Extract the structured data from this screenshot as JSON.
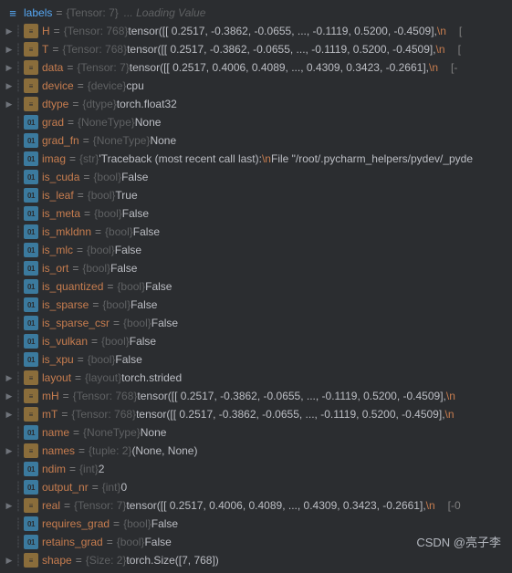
{
  "top": {
    "name": "labels",
    "type": "{Tensor: 7}",
    "loading": "... Loading Value"
  },
  "rows": [
    {
      "arrow": true,
      "pipe": true,
      "icon": "obj",
      "name": "H",
      "type": "{Tensor: 768}",
      "val": "tensor([[ 0.2517, -0.3862, -0.0655,  ..., -0.1119,  0.5200, -0.4509],",
      "esc": "\\n",
      "extra": "["
    },
    {
      "arrow": true,
      "pipe": true,
      "icon": "obj",
      "name": "T",
      "type": "{Tensor: 768}",
      "val": "tensor([[ 0.2517, -0.3862, -0.0655,  ..., -0.1119,  0.5200, -0.4509],",
      "esc": "\\n",
      "extra": "["
    },
    {
      "arrow": true,
      "pipe": true,
      "icon": "obj",
      "name": "data",
      "type": "{Tensor: 7}",
      "val": "tensor([[ 0.2517,  0.4006,  0.4089,  ...,  0.4309,  0.3423, -0.2661],",
      "esc": "\\n",
      "extra": "[-"
    },
    {
      "arrow": true,
      "pipe": true,
      "icon": "obj",
      "name": "device",
      "type": "{device}",
      "val": "cpu"
    },
    {
      "arrow": true,
      "pipe": true,
      "icon": "obj",
      "name": "dtype",
      "type": "{dtype}",
      "val": "torch.float32"
    },
    {
      "arrow": false,
      "pipe": true,
      "icon": "01",
      "name": "grad",
      "type": "{NoneType}",
      "val": "None"
    },
    {
      "arrow": false,
      "pipe": true,
      "icon": "01",
      "name": "grad_fn",
      "type": "{NoneType}",
      "val": "None"
    },
    {
      "arrow": false,
      "pipe": true,
      "icon": "01",
      "name": "imag",
      "type": "{str}",
      "val": "'Traceback (most recent call last):",
      "esc": "\\n",
      "val2": "  File \"/root/.pycharm_helpers/pydev/_pyde"
    },
    {
      "arrow": false,
      "pipe": true,
      "icon": "01",
      "name": "is_cuda",
      "type": "{bool}",
      "val": "False"
    },
    {
      "arrow": false,
      "pipe": true,
      "icon": "01",
      "name": "is_leaf",
      "type": "{bool}",
      "val": "True"
    },
    {
      "arrow": false,
      "pipe": true,
      "icon": "01",
      "name": "is_meta",
      "type": "{bool}",
      "val": "False"
    },
    {
      "arrow": false,
      "pipe": true,
      "icon": "01",
      "name": "is_mkldnn",
      "type": "{bool}",
      "val": "False"
    },
    {
      "arrow": false,
      "pipe": true,
      "icon": "01",
      "name": "is_mlc",
      "type": "{bool}",
      "val": "False"
    },
    {
      "arrow": false,
      "pipe": true,
      "icon": "01",
      "name": "is_ort",
      "type": "{bool}",
      "val": "False"
    },
    {
      "arrow": false,
      "pipe": true,
      "icon": "01",
      "name": "is_quantized",
      "type": "{bool}",
      "val": "False"
    },
    {
      "arrow": false,
      "pipe": true,
      "icon": "01",
      "name": "is_sparse",
      "type": "{bool}",
      "val": "False"
    },
    {
      "arrow": false,
      "pipe": true,
      "icon": "01",
      "name": "is_sparse_csr",
      "type": "{bool}",
      "val": "False"
    },
    {
      "arrow": false,
      "pipe": true,
      "icon": "01",
      "name": "is_vulkan",
      "type": "{bool}",
      "val": "False"
    },
    {
      "arrow": false,
      "pipe": true,
      "icon": "01",
      "name": "is_xpu",
      "type": "{bool}",
      "val": "False"
    },
    {
      "arrow": true,
      "pipe": true,
      "icon": "obj",
      "name": "layout",
      "type": "{layout}",
      "val": "torch.strided"
    },
    {
      "arrow": true,
      "pipe": true,
      "icon": "obj",
      "name": "mH",
      "type": "{Tensor: 768}",
      "val": "tensor([[ 0.2517, -0.3862, -0.0655,  ..., -0.1119,  0.5200, -0.4509],",
      "esc": "\\n"
    },
    {
      "arrow": true,
      "pipe": true,
      "icon": "obj",
      "name": "mT",
      "type": "{Tensor: 768}",
      "val": "tensor([[ 0.2517, -0.3862, -0.0655,  ..., -0.1119,  0.5200, -0.4509],",
      "esc": "\\n"
    },
    {
      "arrow": false,
      "pipe": true,
      "icon": "01",
      "name": "name",
      "type": "{NoneType}",
      "val": "None"
    },
    {
      "arrow": true,
      "pipe": true,
      "icon": "obj",
      "name": "names",
      "type": "{tuple: 2}",
      "val": "(None, None)"
    },
    {
      "arrow": false,
      "pipe": true,
      "icon": "01",
      "name": "ndim",
      "type": "{int}",
      "val": "2"
    },
    {
      "arrow": false,
      "pipe": true,
      "icon": "01",
      "name": "output_nr",
      "type": "{int}",
      "val": "0"
    },
    {
      "arrow": true,
      "pipe": true,
      "icon": "obj",
      "name": "real",
      "type": "{Tensor: 7}",
      "val": "tensor([[ 0.2517,  0.4006,  0.4089,  ...,  0.4309,  0.3423, -0.2661],",
      "esc": "\\n",
      "extra": "[-0"
    },
    {
      "arrow": false,
      "pipe": true,
      "icon": "01",
      "name": "requires_grad",
      "type": "{bool}",
      "val": "False"
    },
    {
      "arrow": false,
      "pipe": true,
      "icon": "01",
      "name": "retains_grad",
      "type": "{bool}",
      "val": "False"
    },
    {
      "arrow": true,
      "pipe": true,
      "icon": "obj",
      "name": "shape",
      "type": "{Size: 2}",
      "val": "torch.Size([7, 768])"
    }
  ],
  "watermark": "CSDN @亮子李",
  "iconLabels": {
    "obj": "≡",
    "01": "01",
    "list": "≡"
  }
}
